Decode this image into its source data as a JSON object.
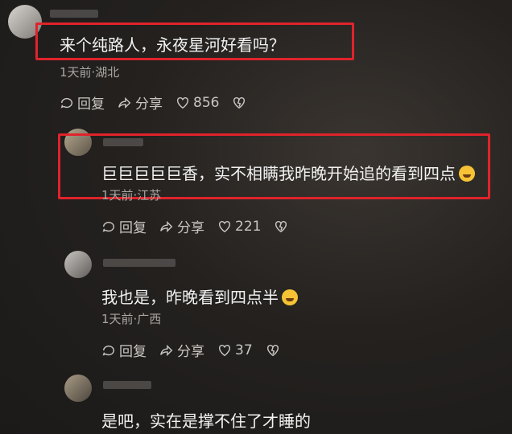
{
  "comments": [
    {
      "text": "来个纯路人，永夜星河好看吗？",
      "meta": "1天前·湖北",
      "reply": "回复",
      "share": "分享",
      "likes": "856"
    },
    {
      "text": "巨巨巨巨巨香，实不相瞒我昨晚开始追的看到四点",
      "meta": "1天前·江苏",
      "reply": "回复",
      "share": "分享",
      "likes": "221"
    },
    {
      "text": "我也是，昨晚看到四点半",
      "meta": "1天前·广西",
      "reply": "回复",
      "share": "分享",
      "likes": "37"
    },
    {
      "text": "是吧，实在是撑不住了才睡的"
    }
  ],
  "icons": {
    "reply": "reply-icon",
    "share": "share-icon",
    "like": "heart-icon",
    "dislike": "broken-heart-icon",
    "emoji": "emoji-icon"
  },
  "colors": {
    "highlight": "#e0232b",
    "background": "#1f1d1c"
  }
}
